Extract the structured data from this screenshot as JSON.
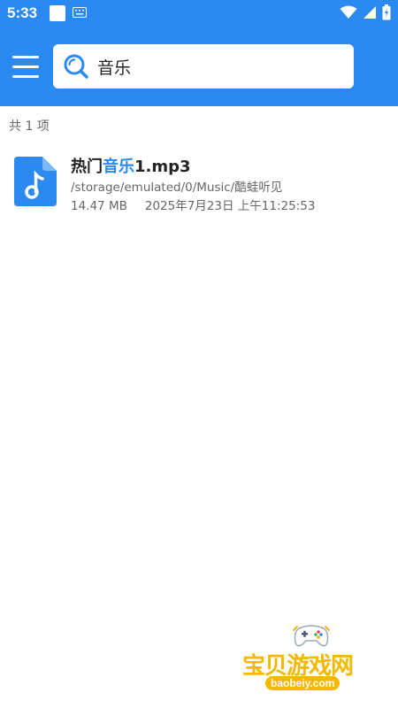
{
  "status_bar": {
    "time": "5:33"
  },
  "search": {
    "query": "音乐"
  },
  "results": {
    "count_label": "共 1 项",
    "items": [
      {
        "name_prefix": "热门",
        "name_highlight": "音乐",
        "name_suffix": "1.mp3",
        "path": "/storage/emulated/0/Music/酷蛙听见",
        "size": "14.47 MB",
        "date": "2025年7月23日 上午11:25:53"
      }
    ]
  },
  "watermark": {
    "title": "宝贝游戏网",
    "url": "baobeiy.com"
  },
  "colors": {
    "accent": "#2A8AF0",
    "watermark": "#F5B800",
    "text_secondary": "#666666"
  }
}
